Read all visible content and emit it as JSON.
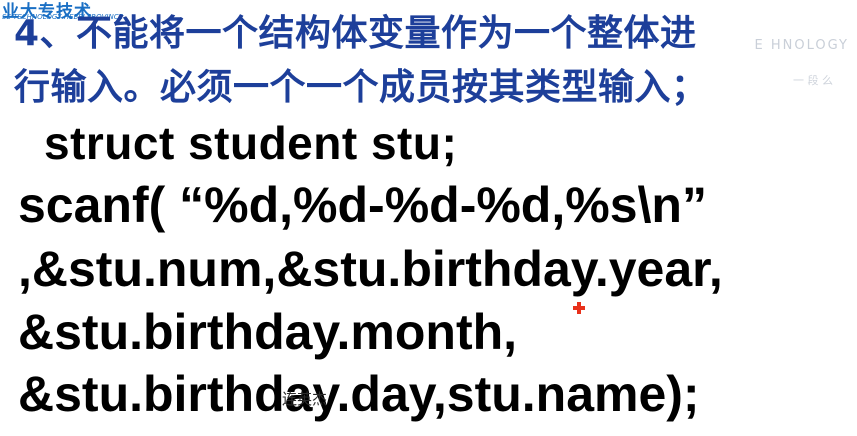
{
  "watermark": {
    "logo_cn": "业大专技术",
    "logo_en": "SE TECHNOLOGY HEBEI PROVINCE",
    "faint_text": "E HNOLOGY",
    "faint_text_2": "一 段 么"
  },
  "slide": {
    "heading_line_1": "4、不能将一个结构体变量作为一个整体进",
    "heading_line_2": "行输入。必须一个一个成员按其类型输入；",
    "code_lines": [
      "struct student stu;",
      "scanf( “%d,%d-%d-%d,%s\\n”",
      ",&stu.num,&stu.birthday.year,",
      "&stu.birthday.month,",
      "&stu.birthday.day,stu.name);"
    ]
  },
  "overlay": {
    "user_tag": "连英杰",
    "marker_color": "#e8311b"
  },
  "colors": {
    "heading": "#1d3f9a",
    "code": "#000000",
    "logo": "#1a6fc4"
  }
}
